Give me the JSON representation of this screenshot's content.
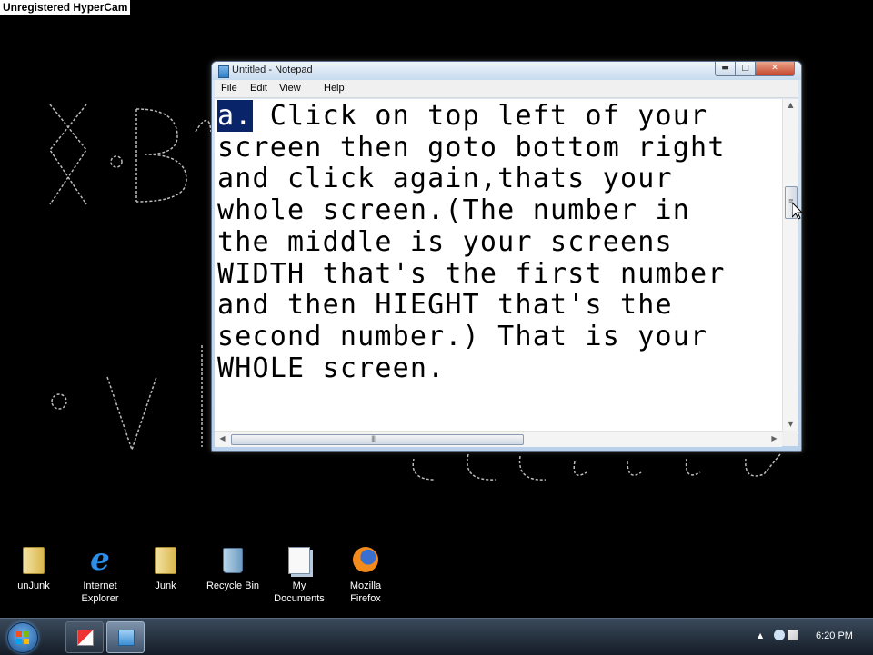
{
  "watermark": "Unregistered HyperCam",
  "notepad": {
    "title": "Untitled - Notepad",
    "controls": {
      "minimize": "▬",
      "maximize": "□",
      "close": "✕"
    },
    "menu": [
      "File",
      "Edit",
      "View",
      "Help"
    ],
    "selected_text": "a.",
    "lines": [
      " Click on top left of your",
      "screen then goto bottom right",
      "and click again,thats your",
      "whole screen.(The number in",
      "the middle is your screens",
      "WIDTH that's the first number",
      "and then HIEGHT that's the",
      "second number.) That is your",
      "WHOLE screen."
    ]
  },
  "desktop_icons": [
    {
      "label": "unJunk",
      "icon": "folder-icon"
    },
    {
      "label": "Internet Explorer",
      "icon": "internet-explorer-icon"
    },
    {
      "label": "Junk",
      "icon": "folder-icon"
    },
    {
      "label": "Recycle Bin",
      "icon": "recycle-bin-icon"
    },
    {
      "label": "My Documents",
      "icon": "my-documents-icon"
    },
    {
      "label": "Mozilla Firefox",
      "icon": "firefox-icon"
    }
  ],
  "taskbar": {
    "clock": "6:20 PM",
    "tray_arrow": "▲"
  },
  "colors": {
    "selection": "#0a246a",
    "desktop": "#000000"
  }
}
